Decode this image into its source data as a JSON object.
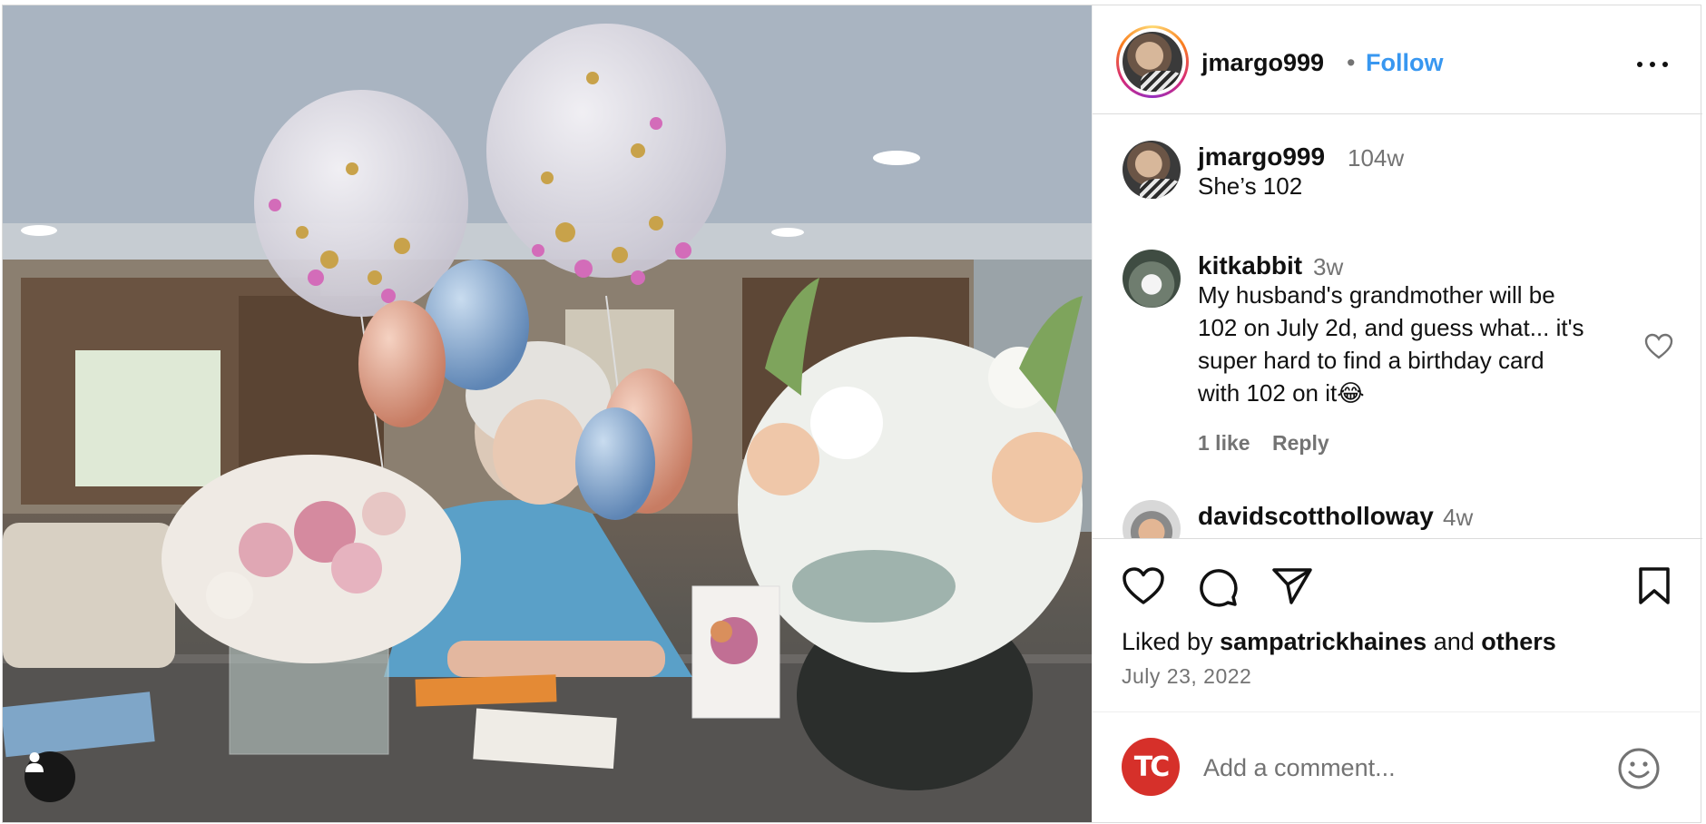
{
  "post": {
    "author": "jmargo999",
    "follow_label": "Follow",
    "separator": "•",
    "more_icon": "more-horizontal-icon"
  },
  "comments": [
    {
      "user": "jmargo999",
      "time": "104w",
      "text": "She’s 102"
    },
    {
      "user": "kitkabbit",
      "time": "3w",
      "lines": [
        "My husband's grandmother will be",
        "102 on July 2d, and guess what... it's",
        "super hard to find a birthday card",
        "with 102 on it😂"
      ],
      "likes": "1 like",
      "reply": "Reply"
    },
    {
      "user": "davidscottholloway",
      "time": "4w"
    }
  ],
  "actions": {
    "liked_prefix": "Liked by ",
    "liked_user": "sampatrickhaines",
    "liked_and": " and ",
    "liked_others": "others",
    "date": "July 23, 2022"
  },
  "add_comment": {
    "avatar_text": "TC",
    "placeholder": "Add a comment..."
  },
  "colors": {
    "accent": "#3897f0",
    "secondary_text": "#737373",
    "border": "#dbdbdb",
    "tc_avatar": "#d6302a"
  }
}
